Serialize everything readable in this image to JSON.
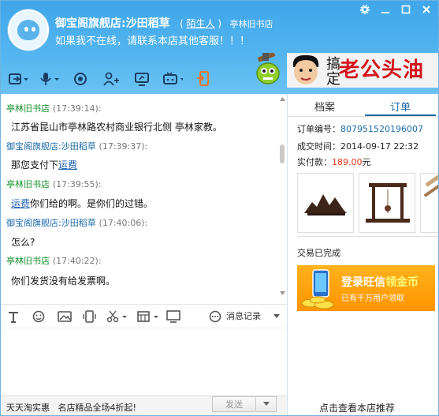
{
  "header": {
    "shop_name": "御宝阁旗舰店:沙田稻草",
    "relation": "陌生人",
    "peer": "亭林旧书店",
    "status_message": "如果我不在线，请联系本店其他客服！！！",
    "banner_big": "老公头油",
    "banner_small": "搞定"
  },
  "window_controls": [
    "gear-icon",
    "minimize-icon",
    "maximize-icon",
    "close-icon"
  ],
  "toolbar": [
    "file-transfer-icon",
    "voice-call-icon",
    "video-call-icon",
    "add-contact-icon",
    "screen-share-icon",
    "remote-assist-icon",
    "mobile-icon"
  ],
  "chat": {
    "messages": [
      {
        "sender": "亭林旧书店",
        "time": "(17:39:14):",
        "kind": "seller",
        "text": "江苏省昆山市亭林路农村商业银行北侧 亭林家教。"
      },
      {
        "sender": "御宝阁旗舰店:沙田稻草",
        "time": "(17:39:37):",
        "kind": "shop",
        "text": "那您支付下",
        "link": "运费"
      },
      {
        "sender": "亭林旧书店",
        "time": "(17:39:55):",
        "kind": "seller",
        "link_first": "运费",
        "text": "你们给的啊。是你们的过错。"
      },
      {
        "sender": "御宝阁旗舰店:沙田稻草",
        "time": "(17:40:06):",
        "kind": "shop",
        "text": "怎么?"
      },
      {
        "sender": "亭林旧书店",
        "time": "(17:40:22):",
        "kind": "seller",
        "text": "你们发货没有给发票啊。"
      }
    ]
  },
  "input_toolbar": {
    "history_label": "消息记录"
  },
  "bottom": {
    "promo_1": "天天淘实惠",
    "promo_2": "名店精品全场4折起!",
    "send_label": "发送"
  },
  "right": {
    "tab_archive": "档案",
    "tab_order": "订单",
    "order_no_label": "订单编号：",
    "order_no": "807951520196007",
    "time_label": "成交时间：",
    "time": "2014-09-17 22:32",
    "paid_label": "实付款：",
    "paid": "189.00",
    "paid_unit": "元",
    "trade_status": "交易已完成",
    "ad_line1a": "登录旺信",
    "ad_line1b": "领金币",
    "ad_line2": "已有千万用户领取",
    "shop_reco": "点击查看本店推荐"
  }
}
